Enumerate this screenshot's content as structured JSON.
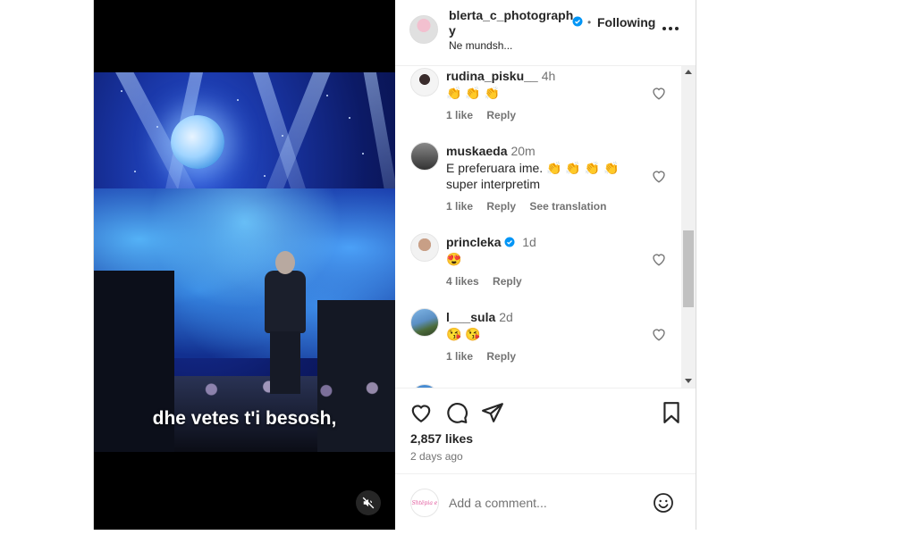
{
  "video": {
    "caption": "dhe vetes t'i besosh,",
    "muted": true
  },
  "header": {
    "username": "blerta_c_photography",
    "follow_label": "Following",
    "separator": "•",
    "subtitle": "Ne mundsh..."
  },
  "comments": [
    {
      "user": "rudina_pisku__",
      "time": "4h",
      "text": "👏 👏 👏",
      "likes": "1 like",
      "reply": "Reply",
      "verified": false
    },
    {
      "user": "muskaeda",
      "time": "20m",
      "text": "E preferuara ime. 👏 👏 👏 👏 super interpretim",
      "likes": "1 like",
      "reply": "Reply",
      "translate": "See translation",
      "verified": false
    },
    {
      "user": "princleka",
      "time": "1d",
      "text": "😍",
      "likes": "4 likes",
      "reply": "Reply",
      "verified": true
    },
    {
      "user": "l___sula",
      "time": "2d",
      "text": "😘 😘",
      "likes": "1 like",
      "reply": "Reply",
      "verified": false
    }
  ],
  "post": {
    "likes": "2,857 likes",
    "posted": "2 days ago"
  },
  "add_comment": {
    "placeholder": "Add a comment...",
    "avatar_text": "Shtëpia e"
  },
  "colors": {
    "verified": "#0095f6",
    "text": "#262626",
    "muted": "#737373"
  }
}
